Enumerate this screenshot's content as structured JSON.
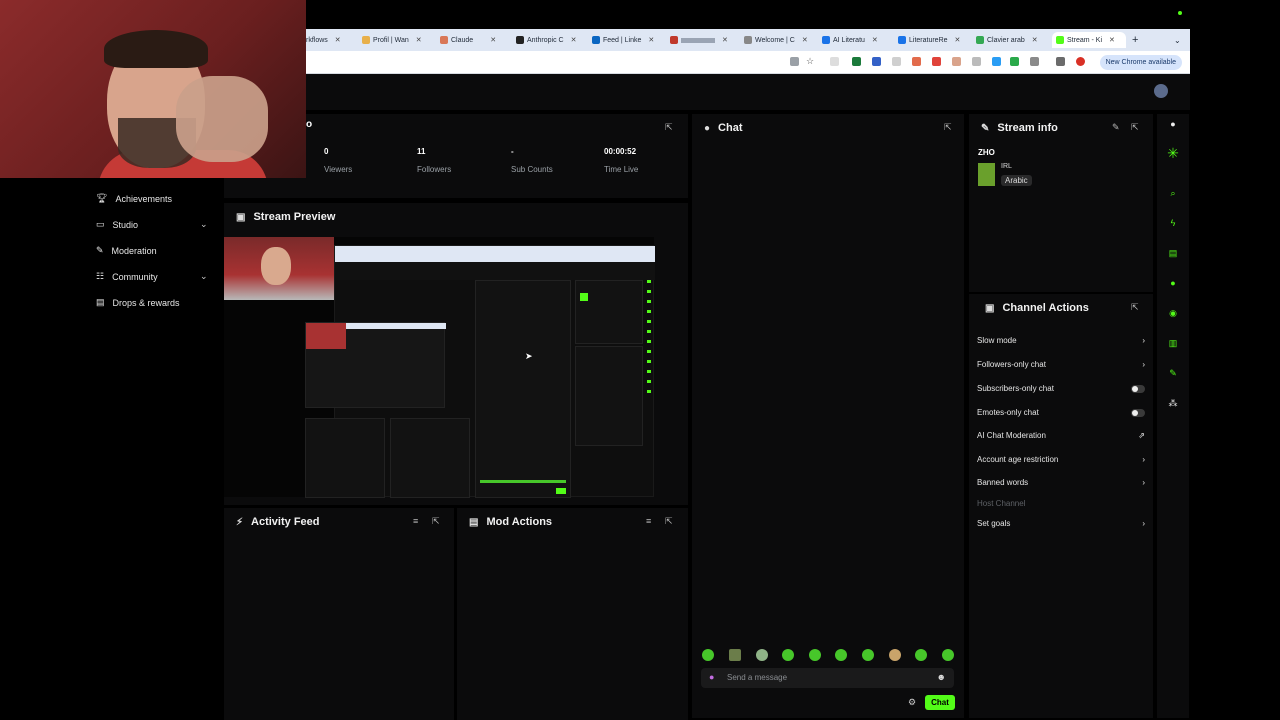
{
  "browser": {
    "tabs": [
      {
        "label": "rkflows",
        "color": "#888"
      },
      {
        "label": "Profil | Wan",
        "color": "#e8b04a"
      },
      {
        "label": "Claude",
        "color": "#d97757"
      },
      {
        "label": "Anthropic C",
        "color": "#222"
      },
      {
        "label": "Feed | Linke",
        "color": "#0a66c2"
      },
      {
        "label": "",
        "color": "#c0392b"
      },
      {
        "label": "Welcome | C",
        "color": "#888"
      },
      {
        "label": "AI Literatu",
        "color": "#1a73e8"
      },
      {
        "label": "LiteratureRe",
        "color": "#1a73e8"
      },
      {
        "label": "Clavier arab",
        "color": "#34a853"
      },
      {
        "label": "Stream - Ki",
        "color": "#53fc18"
      }
    ],
    "new_tab_icon": "plus-icon",
    "new_chrome_label": "New Chrome available"
  },
  "stats": [
    {
      "value": "0",
      "label": "Viewers"
    },
    {
      "value": "11",
      "label": "Followers"
    },
    {
      "value": "-",
      "label": "Sub Counts"
    },
    {
      "value": "00:00:52",
      "label": "Time Live"
    }
  ],
  "sidebar": {
    "items": [
      {
        "label": "Achievements",
        "icon": "trophy-icon",
        "chevron": false
      },
      {
        "label": "Studio",
        "icon": "studio-icon",
        "chevron": true
      },
      {
        "label": "Moderation",
        "icon": "wrench-icon",
        "chevron": false
      },
      {
        "label": "Community",
        "icon": "community-icon",
        "chevron": true
      },
      {
        "label": "Drops & rewards",
        "icon": "gift-icon",
        "chevron": false
      }
    ]
  },
  "panels": {
    "stream_preview": "Stream Preview",
    "activity_feed": "Activity Feed",
    "mod_actions": "Mod Actions",
    "chat": "Chat",
    "stream_info": "Stream info",
    "channel_actions": "Channel Actions",
    "partial_title": "o"
  },
  "stream_info": {
    "title": "ZHO",
    "category": "IRL",
    "language": "Arabic"
  },
  "channel_actions": [
    {
      "label": "Slow mode",
      "control": "chevron"
    },
    {
      "label": "Followers-only chat",
      "control": "chevron"
    },
    {
      "label": "Subscribers-only chat",
      "control": "toggle"
    },
    {
      "label": "Emotes-only chat",
      "control": "toggle"
    },
    {
      "label": "AI Chat Moderation",
      "control": "external"
    },
    {
      "label": "Account age restriction",
      "control": "chevron"
    },
    {
      "label": "Banned words",
      "control": "chevron"
    },
    {
      "label": "Host Channel",
      "control": "none",
      "dim": true
    },
    {
      "label": "Set goals",
      "control": "chevron"
    }
  ],
  "chat": {
    "placeholder": "Send a message",
    "send_label": "Chat"
  },
  "colors": {
    "accent": "#53fc18",
    "panel": "#0b0b0c",
    "background": "#000000"
  }
}
